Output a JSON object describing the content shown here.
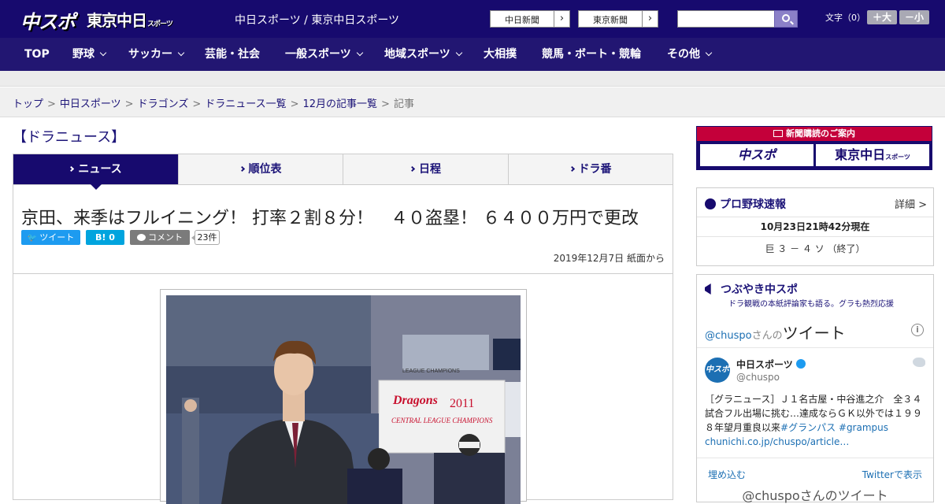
{
  "header": {
    "logo_main": "中スポ",
    "logo_tokyo": "東京中日",
    "logo_tokyo_small": "スポーツ",
    "site_name": "中日スポーツ / 東京中日スポーツ",
    "links": [
      {
        "label": "中日新聞"
      },
      {
        "label": "東京新聞"
      }
    ],
    "search": {
      "placeholder": "",
      "value": ""
    },
    "font_size_label": "文字（0）",
    "font_plus": "＋大",
    "font_minus": "－小"
  },
  "nav": [
    {
      "label": "TOP"
    },
    {
      "label": "野球"
    },
    {
      "label": "サッカー"
    },
    {
      "label": "芸能・社会"
    },
    {
      "label": "一般スポーツ"
    },
    {
      "label": "地域スポーツ"
    },
    {
      "label": "大相撲"
    },
    {
      "label": "競馬・ボート・競輪"
    },
    {
      "label": "その他"
    }
  ],
  "breadcrumb": [
    "トップ",
    "中日スポーツ",
    "ドラゴンズ",
    "ドラニュース一覧",
    "12月の記事一覧",
    "記事"
  ],
  "section_title": "【ドラニュース】",
  "tabs": [
    {
      "label": "ニュース"
    },
    {
      "label": "順位表"
    },
    {
      "label": "日程"
    },
    {
      "label": "ドラ番"
    }
  ],
  "article": {
    "headline": "京田、来季はフルイニング！ 打率２割８分！　４０盗塁！ ６４００万円で更改",
    "tweet_label": "ツイート",
    "hatena_label": "B!",
    "hatena_count": "0",
    "comment_label": "コメント",
    "comment_count": "23件",
    "date": "2019年12月7日 紙面から",
    "photo_banner": "Dragons",
    "photo_banner_year": "2011",
    "photo_banner_sub": "CENTRAL LEAGUE CHAMPIONS",
    "photo_sign": "LEAGUE CHAMPIONS"
  },
  "sidebar": {
    "subscribe": {
      "title": "新聞購読のご案内",
      "logo1": "中スポ",
      "logo2": "東京中日",
      "logo2_small": "スポーツ"
    },
    "baseball": {
      "title": "プロ野球速報",
      "detail": "詳細 >",
      "as_of": "10月23日21時42分現在",
      "score": "巨 ３ － ４ ソ （終了）"
    },
    "tsubuyaki": {
      "title": "つぶやき中スポ",
      "subtitle": "ドラ観戦の本紙評論家も語る。グラも熱烈応援",
      "timeline_handle": "@chuspo",
      "timeline_suffix": "さんの",
      "timeline_label": "ツイート",
      "avatar_text": "中スポ",
      "account_name": "中日スポーツ",
      "account_handle": "@chuspo",
      "tweet_text": "［グラニュース］Ｊ１名古屋・中谷進之介　全３４試合フル出場に挑む…達成ならＧＫ以外では１９９８年望月重良以来",
      "tweet_tags": "#グランパス #grampus",
      "tweet_link": "chunichi.co.jp/chuspo/article…",
      "embed_label": "埋め込む",
      "view_label": "Twitterで表示",
      "bottom_label": "@chuspoさんのツイート"
    }
  }
}
